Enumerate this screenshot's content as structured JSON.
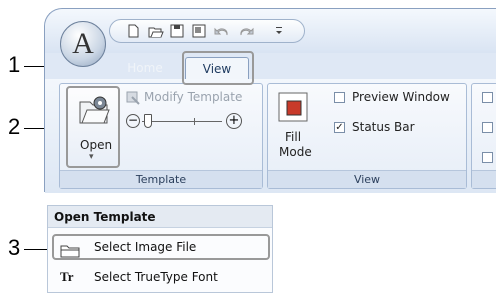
{
  "callouts": {
    "c1": "1",
    "c2": "2",
    "c3": "3"
  },
  "tabs": {
    "home": "Home",
    "view": "View"
  },
  "template_group": {
    "open_label": "Open",
    "open_arrow": "▾",
    "modify_template": "Modify Template",
    "zoom_minus": "−",
    "zoom_plus": "+",
    "group_label": "Template"
  },
  "view_group": {
    "fill_mode_line1": "Fill",
    "fill_mode_line2": "Mode",
    "preview_window": "Preview Window",
    "preview_window_checked": false,
    "status_bar": "Status Bar",
    "status_bar_checked": true,
    "group_label": "View",
    "check_mark": "✓"
  },
  "logo_letter": "A",
  "menu": {
    "title": "Open Template",
    "items": [
      {
        "label": "Select Image File",
        "icon": "folder-icon"
      },
      {
        "label": "Select TrueType Font",
        "icon": "truetype-font-icon",
        "glyph": "Tr"
      }
    ]
  }
}
